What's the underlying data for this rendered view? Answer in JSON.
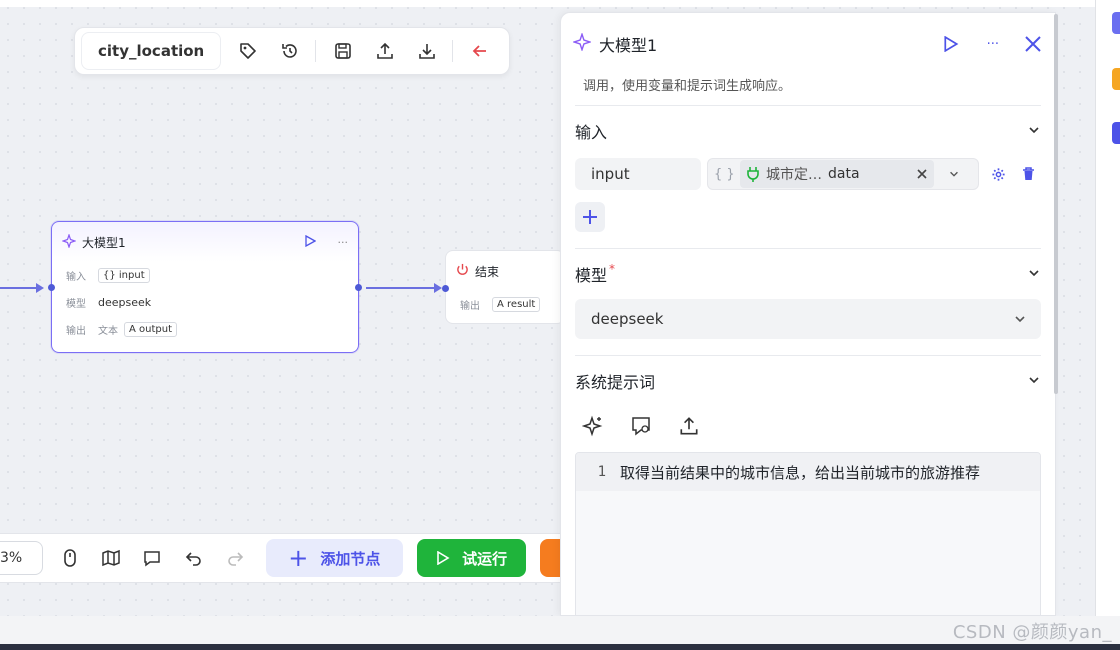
{
  "toolbar": {
    "flow_name": "city_location"
  },
  "llm_node": {
    "title": "大模型1",
    "input_label": "输入",
    "input_chip": "{} input",
    "model_label": "模型",
    "model_value": "deepseek",
    "output_label": "输出",
    "output_type": "文本",
    "output_chip": "A output"
  },
  "end_node": {
    "title": "结束",
    "output_label": "输出",
    "output_chip": "A result"
  },
  "bottom_toolbar": {
    "zoom": "3%",
    "add_node_label": "添加节点",
    "run_label": "试运行"
  },
  "panel": {
    "title": "大模型1",
    "description": "调用，使用变量和提示词生成响应。",
    "input_section": "输入",
    "input_var_name": "input",
    "input_ref_source": "城市定…",
    "input_ref_field": "data",
    "model_section": "模型",
    "model_required": "*",
    "model_value": "deepseek",
    "prompt_section": "系统提示词",
    "prompt_line_no": "1",
    "prompt_text": "取得当前结果中的城市信息，给出当前城市的旅游推荐"
  },
  "watermark": "CSDN @颜颜yan_",
  "colors": {
    "accent": "#4d53e8",
    "run_green": "#1fb43b",
    "node_border": "#7b6ef5",
    "danger": "#e5484d"
  }
}
